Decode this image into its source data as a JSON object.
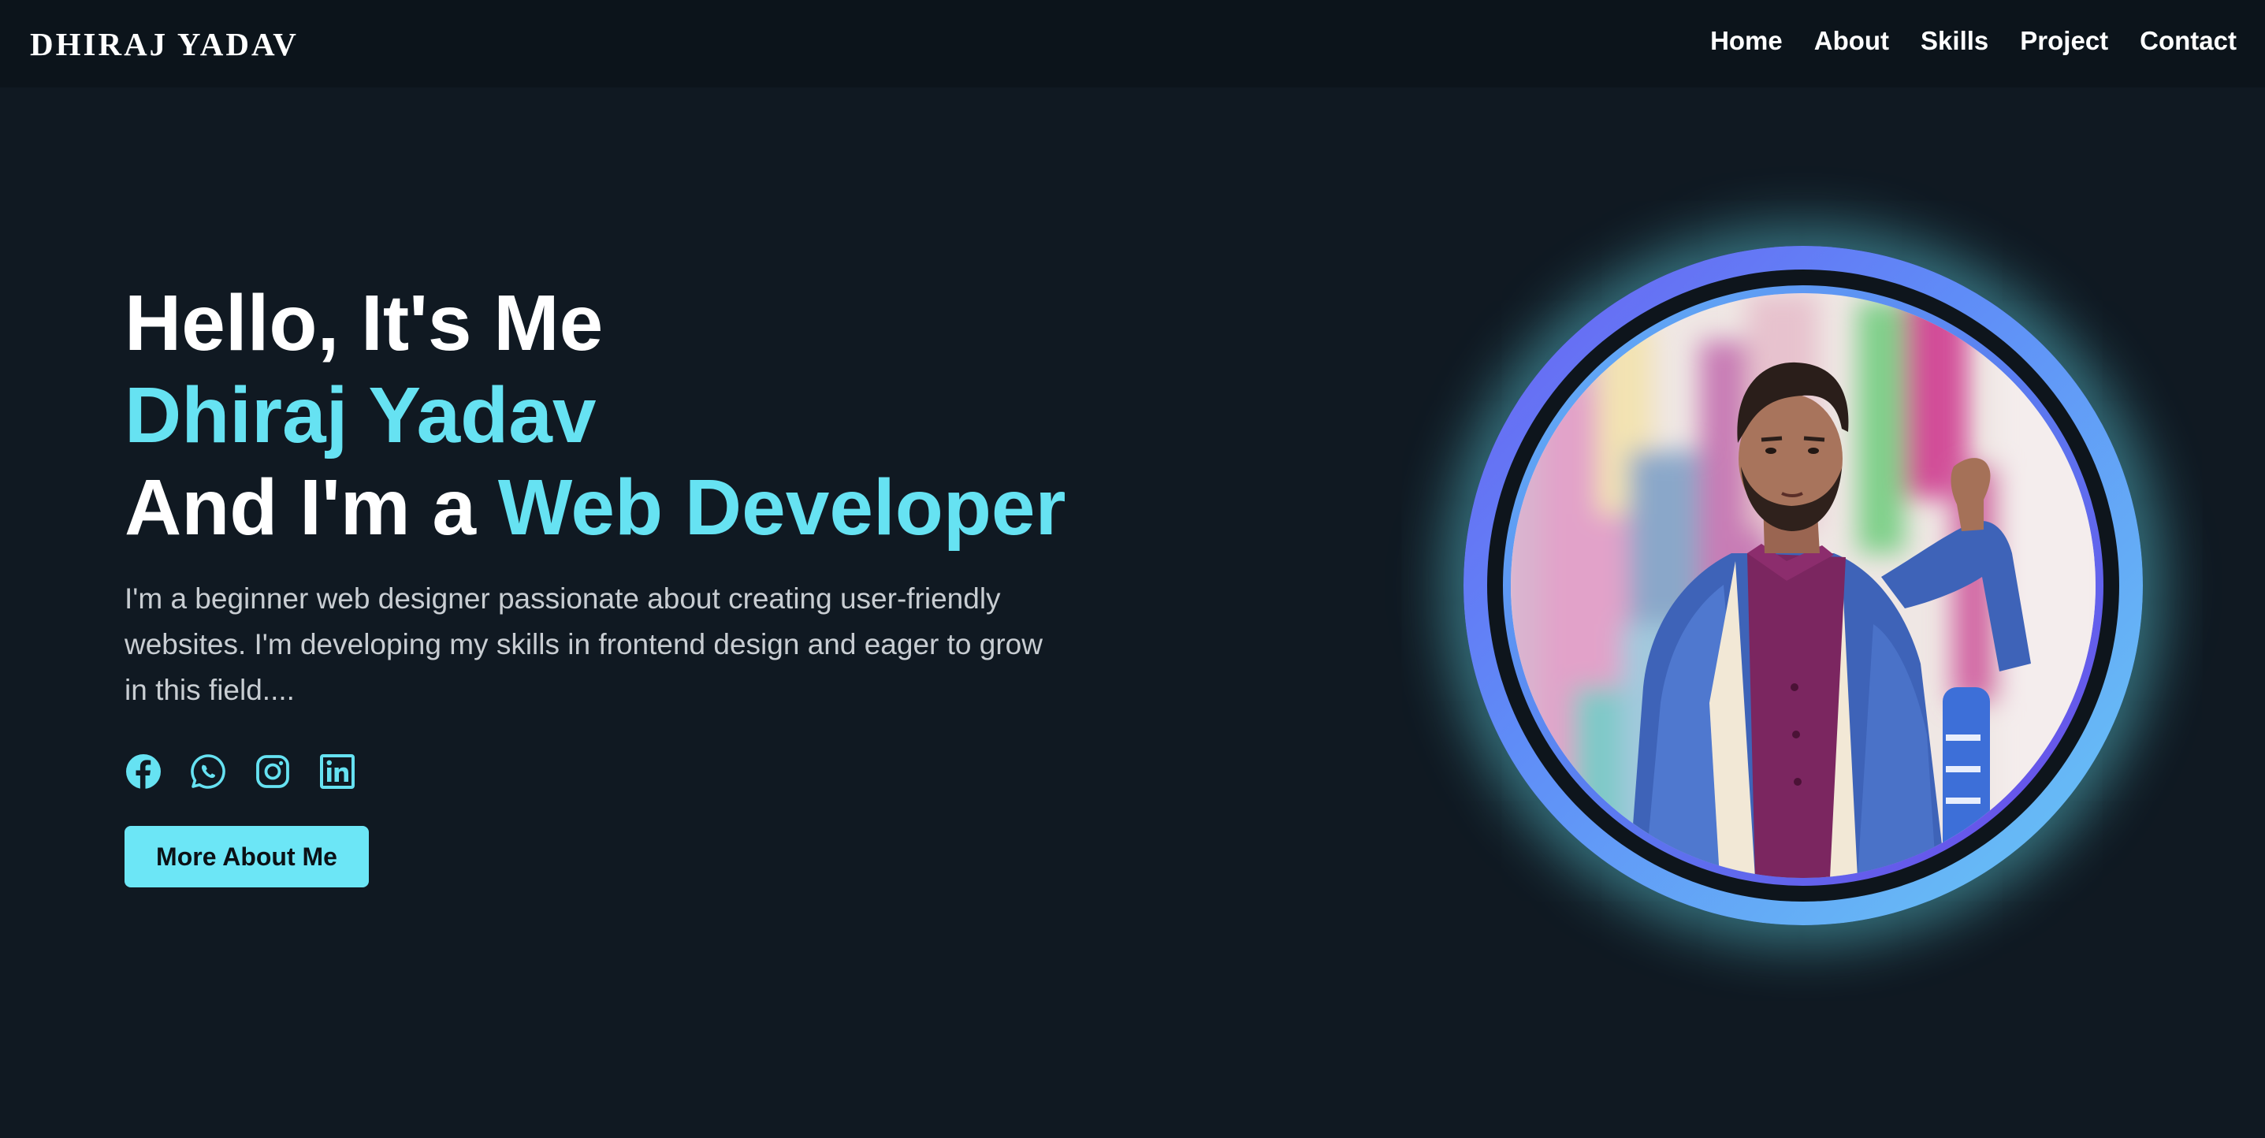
{
  "header": {
    "logo": "DHIRAJ YADAV",
    "nav": [
      {
        "label": "Home"
      },
      {
        "label": "About"
      },
      {
        "label": "Skills"
      },
      {
        "label": "Project"
      },
      {
        "label": "Contact"
      }
    ]
  },
  "hero": {
    "greeting": "Hello, It's Me",
    "name": "Dhiraj Yadav",
    "role_prefix": "And I'm a ",
    "role": "Web Developer",
    "description": "I'm a beginner web designer passionate about creating user-friendly websites. I'm developing my skills in frontend design and eager to grow in this field....",
    "socials": [
      {
        "icon": "facebook-icon"
      },
      {
        "icon": "whatsapp-icon"
      },
      {
        "icon": "instagram-icon"
      },
      {
        "icon": "linkedin-icon"
      }
    ],
    "cta_label": "More About Me"
  },
  "colors": {
    "background": "#101922",
    "navbar": "#0c141b",
    "accent": "#66e2f2",
    "button": "#6ce6f6",
    "text": "#ffffff",
    "muted_text": "#c8cdd2"
  }
}
